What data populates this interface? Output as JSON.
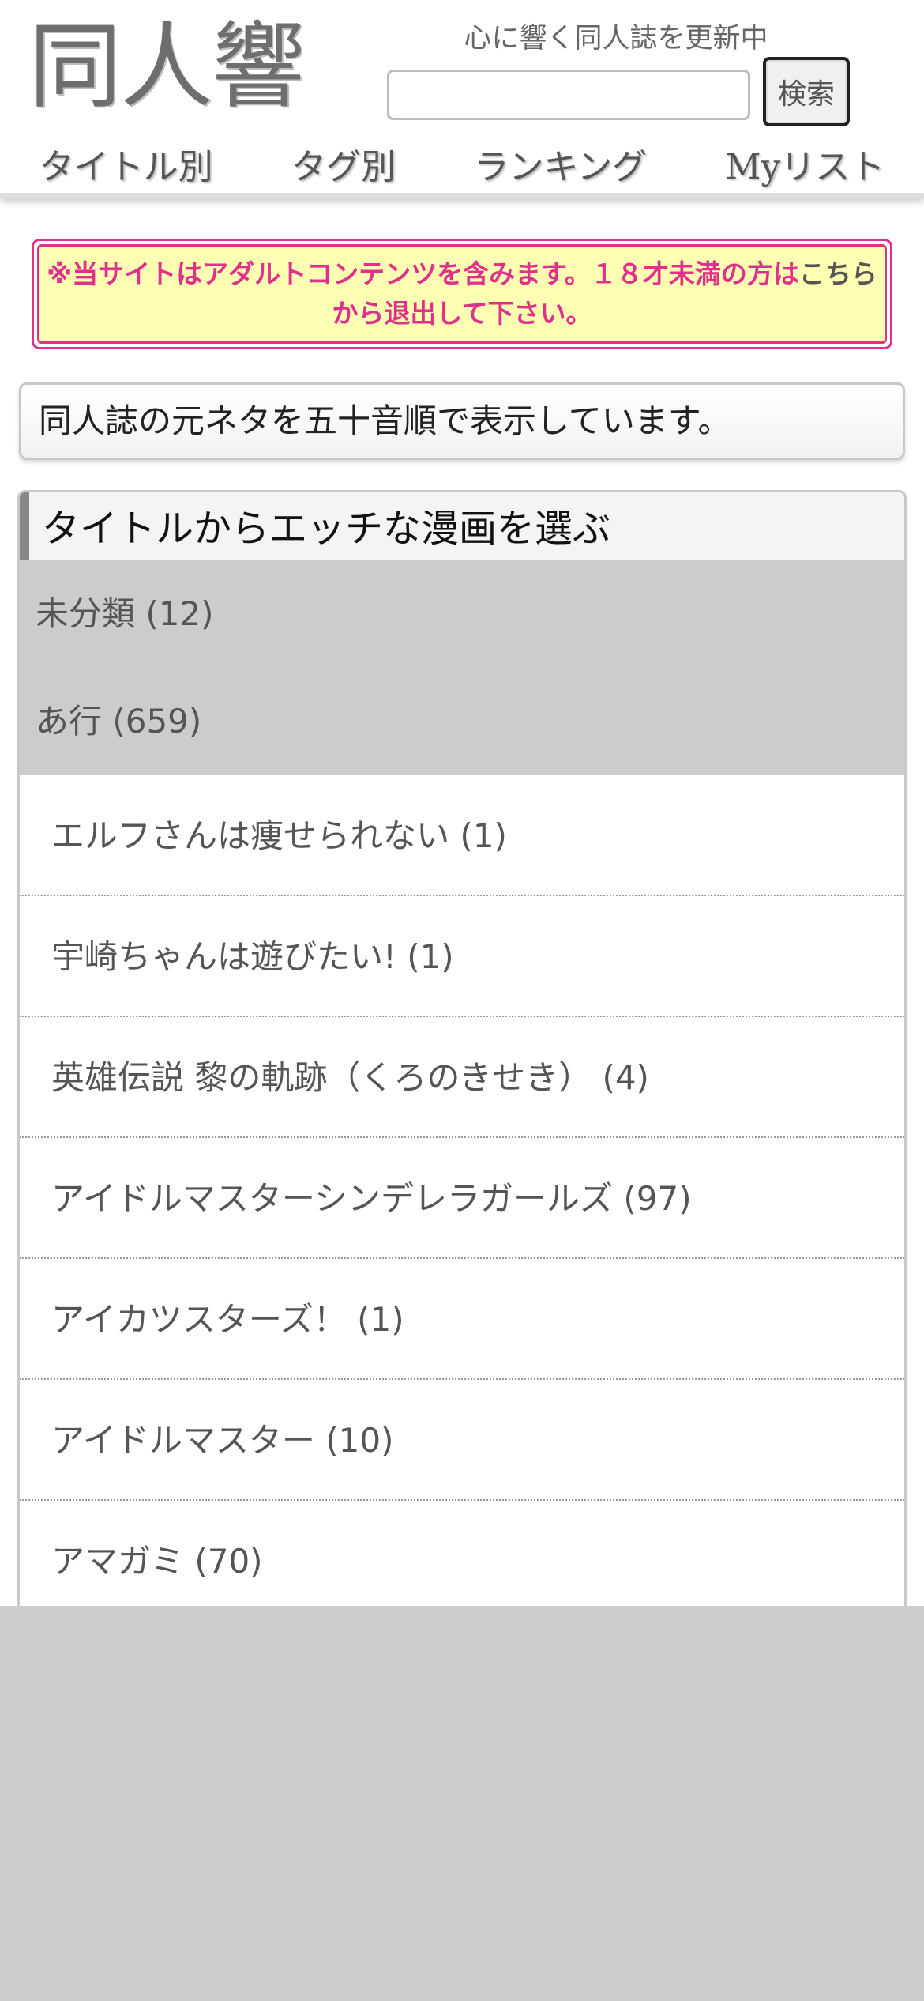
{
  "header": {
    "logo": "同人響",
    "tagline": "心に響く同人誌を更新中",
    "search": {
      "value": "",
      "placeholder": "",
      "button_label": "検索"
    },
    "nav": [
      {
        "label": "タイトル別"
      },
      {
        "label": "タグ別"
      },
      {
        "label": "ランキング"
      },
      {
        "label": "Myリスト"
      }
    ]
  },
  "warning": {
    "text": "※当サイトはアダルトコンテンツを含みます。１８才未満の方は",
    "link_text": "こちら",
    "text_after": "から退出して下さい。"
  },
  "description": "同人誌の元ネタを五十音順で表示しています。",
  "category_panel": {
    "title": "タイトルからエッチな漫画を選ぶ",
    "groups": [
      {
        "label": "未分類 (12)"
      },
      {
        "label": "あ行 (659)"
      }
    ],
    "titles": [
      {
        "label": "エルフさんは痩せられない (1)"
      },
      {
        "label": "宇崎ちゃんは遊びたい! (1)"
      },
      {
        "label": "英雄伝説 黎の軌跡（くろのきせき） (4)"
      },
      {
        "label": "アイドルマスターシンデレラガールズ (97)"
      },
      {
        "label": "アイカツスターズ！ (1)"
      },
      {
        "label": "アイドルマスター (10)"
      },
      {
        "label": "アマガミ (70)"
      }
    ]
  },
  "colors": {
    "warning_accent": "#e0308a",
    "warning_background": "#ffffb4",
    "page_background": "#cccccc",
    "group_header_background": "#cccccc"
  }
}
